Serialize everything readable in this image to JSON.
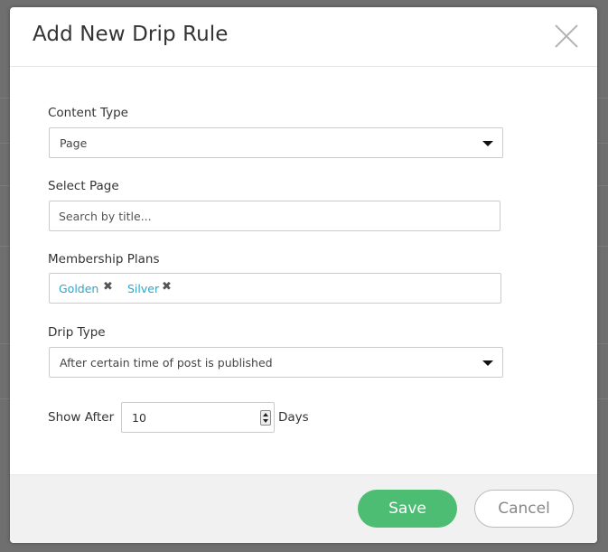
{
  "modal": {
    "title": "Add New Drip Rule",
    "close_icon": "close-icon"
  },
  "form": {
    "content_type": {
      "label": "Content Type",
      "value": "Page"
    },
    "select_page": {
      "label": "Select Page",
      "placeholder": "Search by title..."
    },
    "membership_plans": {
      "label": "Membership Plans",
      "tags": [
        "Golden",
        "Silver"
      ],
      "remove_symbol": "✖"
    },
    "drip_type": {
      "label": "Drip Type",
      "value": "After certain time of post is published"
    },
    "show_after": {
      "label": "Show After",
      "value": "10",
      "unit": "Days"
    }
  },
  "footer": {
    "save_label": "Save",
    "cancel_label": "Cancel"
  },
  "colors": {
    "accent_green": "#4dbd74",
    "tag_blue": "#2aa7c9",
    "overlay": "#6f6f6f"
  }
}
